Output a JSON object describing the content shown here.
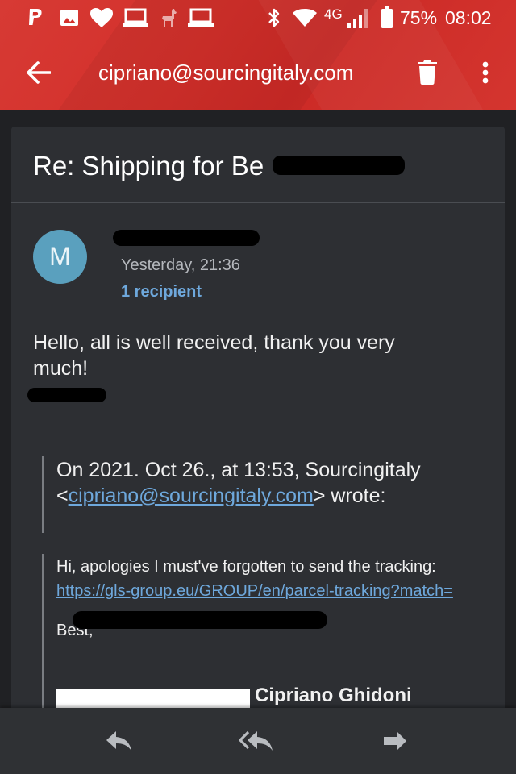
{
  "status_bar": {
    "network": "4G",
    "battery": "75%",
    "time": "08:02"
  },
  "toolbar": {
    "title": "cipriano@sourcingitaly.com"
  },
  "email": {
    "subject": "Re: Shipping for Be",
    "sender_initial": "M",
    "date": "Yesterday, 21:36",
    "recipients": "1 recipient",
    "body_line1": "Hello, all is well received, thank you very much!",
    "quote_header_prefix": "On 2021. Oct 26., at 13:53, Sourcingitaly <",
    "quote_header_email": "cipriano@sourcingitaly.com",
    "quote_header_suffix": "> wrote:",
    "quote_body": "Hi, apologies I must've forgotten to send the tracking:",
    "tracking_url": "https://gls-group.eu/GROUP/en/parcel-tracking?match=",
    "closing": "Best,",
    "signature": "Cipriano Ghidoni"
  },
  "colors": {
    "header_red": "#d3302b",
    "background": "#202124",
    "card": "#2d2f33",
    "link_blue": "#6ea8dc",
    "avatar": "#5aa0be"
  },
  "icons": {
    "status": [
      "paypal-icon",
      "image-icon",
      "heart-icon",
      "laptop-icon",
      "llama-icon",
      "laptop-icon",
      "bluetooth-icon",
      "wifi-icon",
      "signal-icon",
      "battery-icon"
    ],
    "toolbar": [
      "back-arrow-icon",
      "trash-icon",
      "more-vert-icon"
    ],
    "bottom": [
      "reply-icon",
      "reply-all-icon",
      "forward-icon"
    ]
  }
}
